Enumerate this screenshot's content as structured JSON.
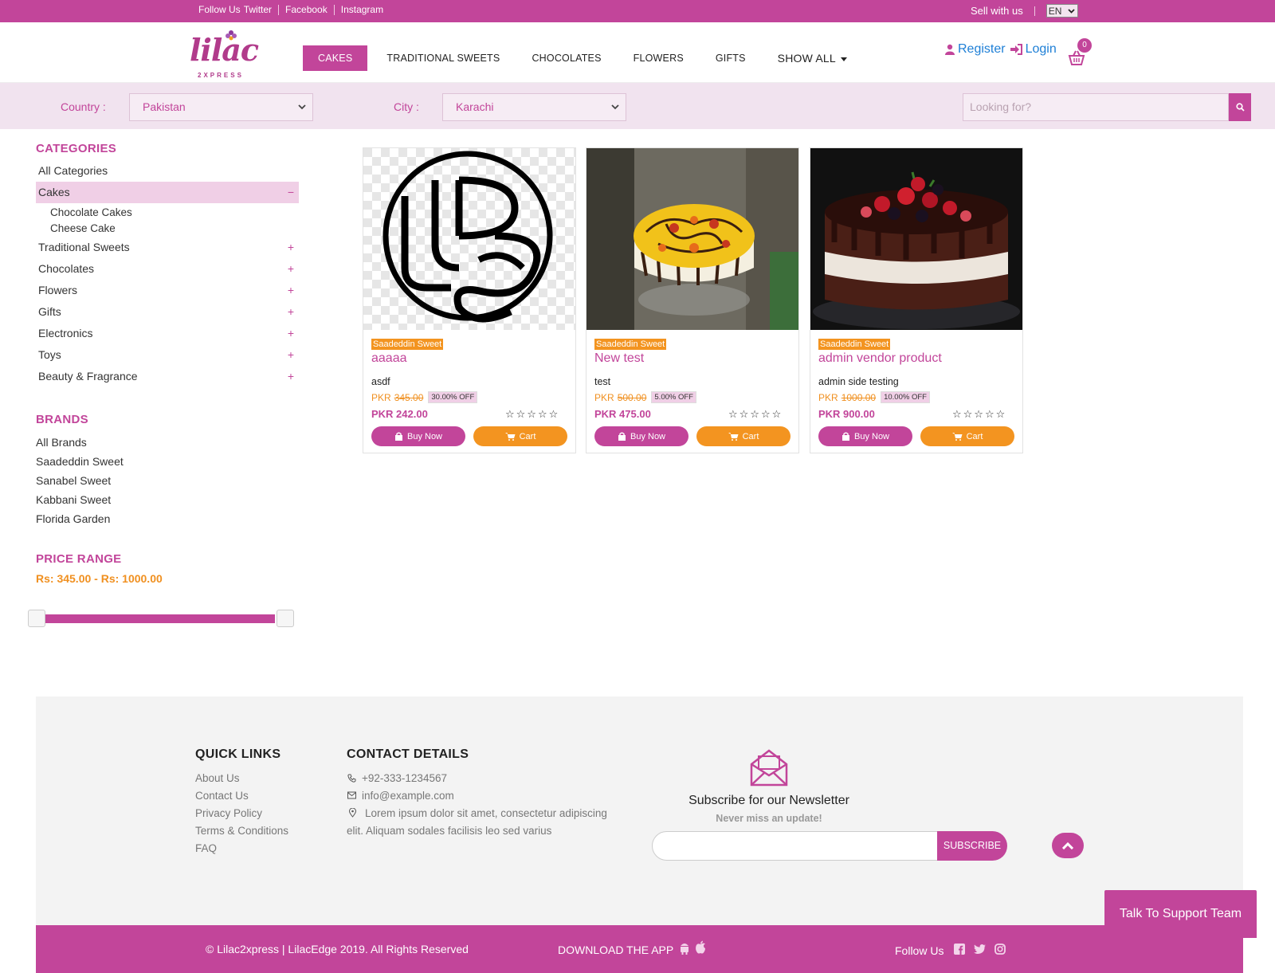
{
  "topbar": {
    "follow_label": "Follow Us",
    "social": [
      "Twitter",
      "Facebook",
      "Instagram"
    ],
    "sell_label": "Sell with us",
    "lang": "EN"
  },
  "brand": {
    "name": "lilac",
    "tagline": "2XPRESS"
  },
  "nav": {
    "items": [
      "CAKES",
      "TRADITIONAL SWEETS",
      "CHOCOLATES",
      "FLOWERS",
      "GIFTS"
    ],
    "show_all": "SHOW ALL",
    "active": "CAKES"
  },
  "auth": {
    "register": "Register",
    "login": "Login",
    "cart_count": "0"
  },
  "filters": {
    "country_label": "Country :",
    "country_value": "Pakistan",
    "city_label": "City :",
    "city_value": "Karachi",
    "search_placeholder": "Looking for?"
  },
  "sidebar": {
    "categories_title": "CATEGORIES",
    "all_categories": "All Categories",
    "active_category": "Cakes",
    "active_toggle": "−",
    "subcategories": [
      "Chocolate Cakes",
      "Cheese Cake"
    ],
    "categories": [
      {
        "label": "Traditional Sweets",
        "toggle": "+"
      },
      {
        "label": "Chocolates",
        "toggle": "+"
      },
      {
        "label": "Flowers",
        "toggle": "+"
      },
      {
        "label": "Gifts",
        "toggle": "+"
      },
      {
        "label": "Electronics",
        "toggle": "+"
      },
      {
        "label": "Toys",
        "toggle": "+"
      },
      {
        "label": "Beauty & Fragrance",
        "toggle": "+"
      }
    ],
    "brands_title": "BRANDS",
    "brands": [
      "All Brands",
      "Saadeddin Sweet",
      "Sanabel Sweet",
      "Kabbani Sweet",
      "Florida Garden"
    ],
    "price_title": "PRICE RANGE",
    "price_text": "Rs: 345.00 - Rs: 1000.00",
    "price_min": 345,
    "price_max": 1000
  },
  "products": [
    {
      "vendor": "Saadeddin Sweet",
      "title": "aaaaa",
      "description": "asdf",
      "currency": "PKR",
      "old_price": "345.00",
      "discount": "30.00% OFF",
      "price": "PKR 242.00",
      "stars": "☆☆☆☆☆",
      "buy_label": "Buy Now",
      "cart_label": "Cart",
      "image": "logo-image"
    },
    {
      "vendor": "Saadeddin Sweet",
      "title": "New test",
      "description": "test",
      "currency": "PKR",
      "old_price": "500.00",
      "discount": "5.00% OFF",
      "price": "PKR 475.00",
      "stars": "☆☆☆☆☆",
      "buy_label": "Buy Now",
      "cart_label": "Cart",
      "image": "fruit-cake-image"
    },
    {
      "vendor": "Saadeddin Sweet",
      "title": "admin vendor product",
      "description": "admin side testing",
      "currency": "PKR",
      "old_price": "1000.00",
      "discount": "10.00% OFF",
      "price": "PKR 900.00",
      "stars": "☆☆☆☆☆",
      "buy_label": "Buy Now",
      "cart_label": "Cart",
      "image": "berry-cake-image"
    }
  ],
  "footer": {
    "quick_links_title": "QUICK LINKS",
    "quick_links": [
      "About Us",
      "Contact Us",
      "Privacy Policy",
      "Terms & Conditions",
      "FAQ"
    ],
    "contact_title": "CONTACT DETAILS",
    "phone": "+92-333-1234567",
    "email": "info@example.com",
    "address_line1": "Lorem ipsum dolor sit amet, consectetur adipiscing",
    "address_line2": "elit. Aliquam sodales facilisis leo sed varius",
    "newsletter_title": "Subscribe for our Newsletter",
    "newsletter_sub": "Never miss an update!",
    "subscribe_label": "SUBSCRIBE",
    "copyright": "© Lilac2xpress | LilacEdge 2019. All Rights Reserved",
    "download_label": "DOWNLOAD THE APP",
    "follow_label": "Follow Us",
    "support_label": "Talk To Support Team"
  },
  "colors": {
    "brand": "#c2459a",
    "accent": "#f39420",
    "filter_bg": "#f1e3ef"
  }
}
